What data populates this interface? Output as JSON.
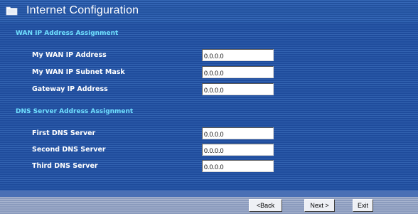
{
  "header": {
    "title": "Internet Configuration"
  },
  "wan": {
    "section_title": "WAN IP Address Assignment",
    "rows": [
      {
        "label": "My WAN IP Address",
        "value": "0.0.0.0"
      },
      {
        "label": "My WAN IP Subnet Mask",
        "value": "0.0.0.0"
      },
      {
        "label": "Gateway IP Address",
        "value": "0.0.0.0"
      }
    ]
  },
  "dns": {
    "section_title": "DNS Server Address Assignment",
    "rows": [
      {
        "label": "First DNS Server",
        "value": "0.0.0.0"
      },
      {
        "label": "Second DNS Server",
        "value": "0.0.0.0"
      },
      {
        "label": "Third DNS Server",
        "value": "0.0.0.0"
      }
    ]
  },
  "buttons": {
    "back": "<Back",
    "next": "Next >",
    "exit": "Exit"
  },
  "colors": {
    "section_title": "#6fe0ff",
    "background": "#2c5aa8"
  },
  "icons": {
    "title_icon": "folder-icon"
  }
}
